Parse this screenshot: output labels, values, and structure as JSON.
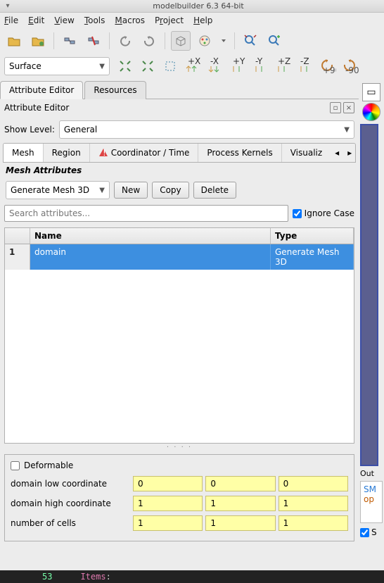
{
  "window": {
    "title": "modelbuilder 6.3 64-bit"
  },
  "menu": {
    "file": "File",
    "edit": "Edit",
    "view": "View",
    "tools": "Tools",
    "macros": "Macros",
    "project": "Project",
    "help": "Help"
  },
  "surface_dropdown": {
    "value": "Surface"
  },
  "panel_tabs": {
    "attribute_editor": "Attribute Editor",
    "resources": "Resources"
  },
  "panel_header": {
    "title": "Attribute Editor"
  },
  "show_level": {
    "label": "Show Level:",
    "value": "General"
  },
  "inner_tabs": {
    "mesh": "Mesh",
    "region": "Region",
    "coord": "Coordinator / Time",
    "process": "Process Kernels",
    "visual": "Visualiz"
  },
  "section_label": "Mesh Attributes",
  "gen_dropdown": {
    "value": "Generate Mesh 3D"
  },
  "buttons": {
    "new": "New",
    "copy": "Copy",
    "delete": "Delete"
  },
  "search": {
    "placeholder": "Search attributes...",
    "ignore": "Ignore Case"
  },
  "table": {
    "headers": {
      "num": "",
      "name": "Name",
      "type": "Type"
    },
    "rows": [
      {
        "num": "1",
        "name": "domain",
        "type": "Generate Mesh 3D"
      }
    ]
  },
  "props": {
    "deformable": "Deformable",
    "rows": [
      {
        "label": "domain low coordinate",
        "v": [
          "0",
          "0",
          "0"
        ]
      },
      {
        "label": "domain high coordinate",
        "v": [
          "1",
          "1",
          "1"
        ]
      },
      {
        "label": "number of cells",
        "v": [
          "1",
          "1",
          "1"
        ]
      }
    ]
  },
  "right": {
    "output_label": "Out",
    "code1": "SM",
    "code2": "op",
    "bot_check": "S"
  },
  "footer": {
    "num": "53",
    "items": "Items",
    "colon": ":"
  }
}
